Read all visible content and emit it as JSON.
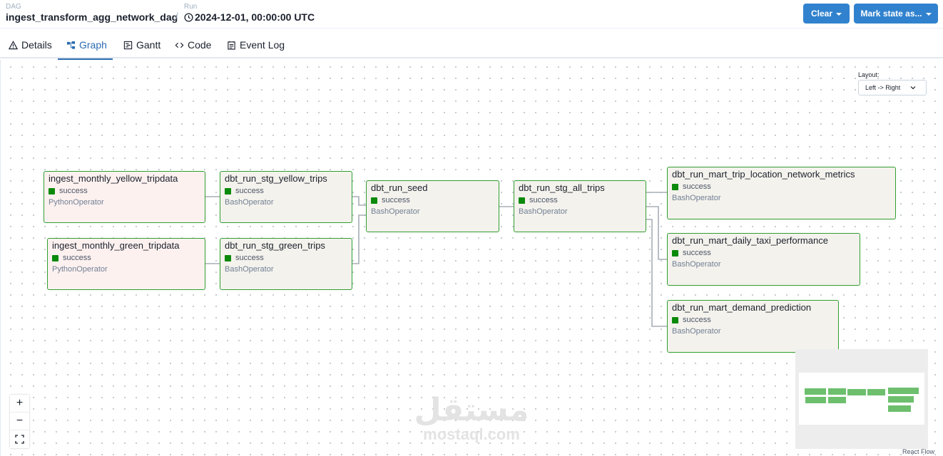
{
  "header": {
    "dag_label": "DAG",
    "dag_id": "ingest_transform_agg_network_dag",
    "separator": "/",
    "run_label": "Run",
    "run_id": "2024-12-01, 00:00:00 UTC",
    "clear_label": "Clear",
    "mark_state_label": "Mark state as..."
  },
  "tabs": [
    {
      "label": "Details",
      "icon": "warning-icon"
    },
    {
      "label": "Graph",
      "icon": "graph-icon",
      "active": true
    },
    {
      "label": "Gantt",
      "icon": "gantt-icon"
    },
    {
      "label": "Code",
      "icon": "code-icon"
    },
    {
      "label": "Event Log",
      "icon": "event-log-icon"
    }
  ],
  "layout": {
    "label": "Layout:",
    "value": "Left -> Right"
  },
  "colors": {
    "success": "#0a8a0a",
    "node_border": "#2f9e2f",
    "accent": "#3182ce"
  },
  "nodes": [
    {
      "task": "ingest_monthly_yellow_tripdata",
      "state": "success",
      "operator": "PythonOperator"
    },
    {
      "task": "ingest_monthly_green_tripdata",
      "state": "success",
      "operator": "PythonOperator"
    },
    {
      "task": "dbt_run_stg_yellow_trips",
      "state": "success",
      "operator": "BashOperator"
    },
    {
      "task": "dbt_run_stg_green_trips",
      "state": "success",
      "operator": "BashOperator"
    },
    {
      "task": "dbt_run_seed",
      "state": "success",
      "operator": "BashOperator"
    },
    {
      "task": "dbt_run_stg_all_trips",
      "state": "success",
      "operator": "BashOperator"
    },
    {
      "task": "dbt_run_mart_trip_location_network_metrics",
      "state": "success",
      "operator": "BashOperator"
    },
    {
      "task": "dbt_run_mart_daily_taxi_performance",
      "state": "success",
      "operator": "BashOperator"
    },
    {
      "task": "dbt_run_mart_demand_prediction",
      "state": "success",
      "operator": "BashOperator"
    }
  ],
  "zoom": {
    "in": "+",
    "out": "−",
    "fit": "fit-view-icon"
  },
  "watermark": {
    "arabic": "مستقل",
    "latin": "mostaql.com"
  },
  "credit": "React Flow"
}
